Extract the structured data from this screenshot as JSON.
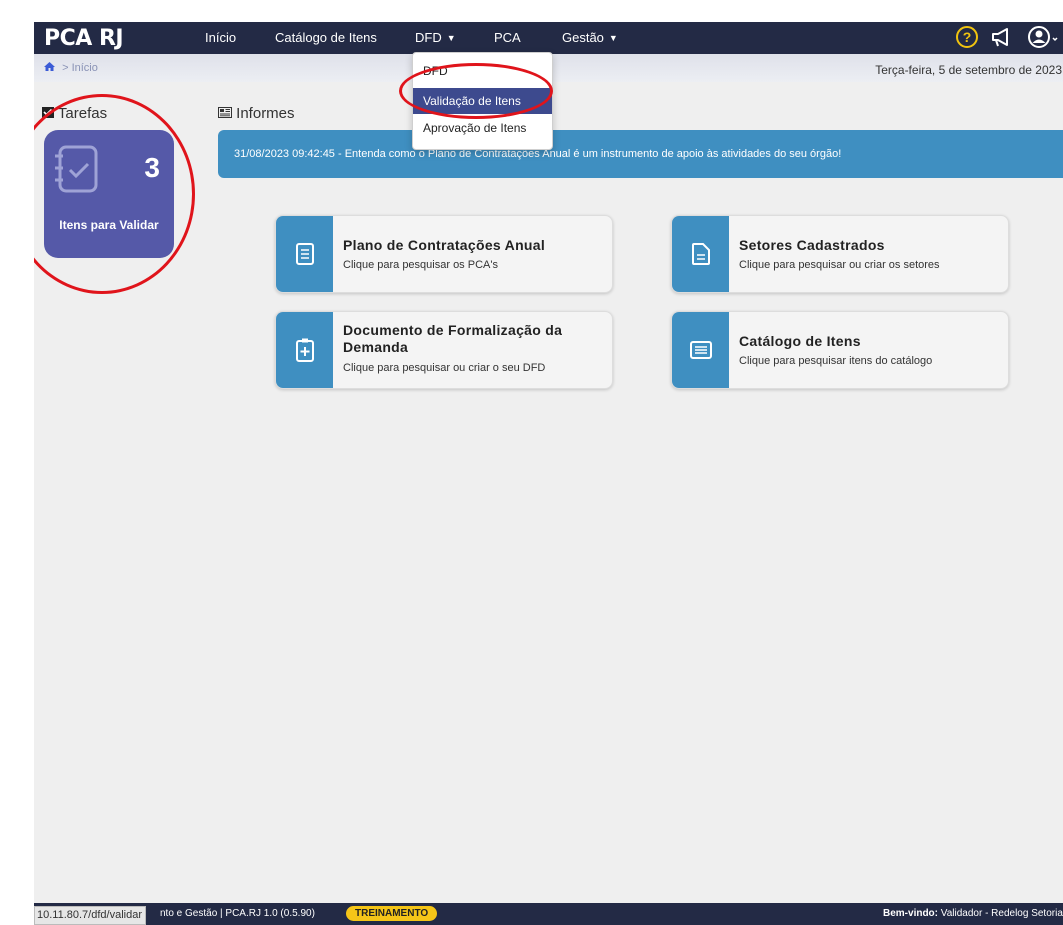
{
  "navbar": {
    "logo": "PCA RJ",
    "items": [
      {
        "label": "Início"
      },
      {
        "label": "Catálogo de Itens"
      },
      {
        "label": "DFD"
      },
      {
        "label": "PCA"
      },
      {
        "label": "Gestão"
      }
    ],
    "help_symbol": "?"
  },
  "breadcrumb": {
    "home_icon": "home-icon",
    "separator": ">",
    "current": "Início"
  },
  "date": "Terça-feira, 5 de setembro de 2023",
  "dropdown": {
    "items": [
      {
        "label": "DFD"
      },
      {
        "label": "Validação de Itens",
        "active": true
      },
      {
        "label": "Aprovação de Itens"
      }
    ]
  },
  "tasks": {
    "title": "Tarefas",
    "card": {
      "count": "3",
      "label": "Itens para Validar"
    }
  },
  "news": {
    "title": "Informes",
    "banner": "31/08/2023 09:42:45 - Entenda como o Plano de Contratações Anual é um instrumento de apoio às atividades do seu órgão!"
  },
  "cards": [
    {
      "title": "Plano de Contratações Anual",
      "subtitle": "Clique para pesquisar os PCA's",
      "icon": "document-icon"
    },
    {
      "title": "Setores Cadastrados",
      "subtitle": "Clique para pesquisar ou criar os setores",
      "icon": "file-icon"
    },
    {
      "title": "Documento de Formalização da Demanda",
      "subtitle": "Clique para pesquisar ou criar o seu DFD",
      "icon": "clipboard-plus-icon"
    },
    {
      "title": "Catálogo de Itens",
      "subtitle": "Clique para pesquisar itens do catálogo",
      "icon": "list-icon"
    }
  ],
  "footer": {
    "left": "nto e Gestão | PCA.RJ 1.0 (0.5.90)",
    "badge": "TREINAMENTO",
    "welcome_label": "Bem-vindo:",
    "welcome_user": " Validador - Redelog Setorial"
  },
  "status_url": "10.11.80.7/dfd/validar",
  "colors": {
    "navbar": "#232a45",
    "accent": "#3f8fc1",
    "task_card": "#5559a8",
    "badge": "#f5c518",
    "annotation": "#e0141b"
  }
}
